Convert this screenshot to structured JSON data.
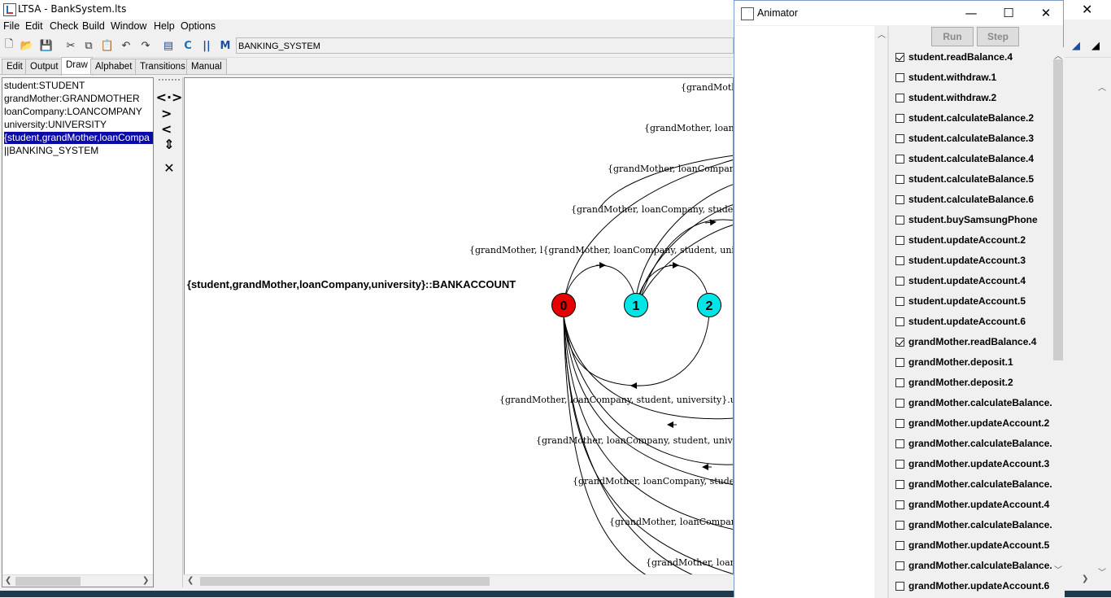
{
  "main_window": {
    "title": "LTSA - BankSystem.lts",
    "menu": [
      "File",
      "Edit",
      "Check",
      "Build",
      "Window",
      "Help",
      "Options"
    ],
    "target": "BANKING_SYSTEM",
    "tabs": [
      "Edit",
      "Output",
      "Draw",
      "Alphabet",
      "Transitions",
      "Manual"
    ],
    "active_tab": "Draw"
  },
  "process_list": [
    "student:STUDENT",
    "grandMother:GRANDMOTHER",
    "loanCompany:LOANCOMPANY",
    "university:UNIVERSITY",
    "{student,grandMother,loanCompa",
    "||BANKING_SYSTEM"
  ],
  "diagram": {
    "process_title": "{student,grandMother,loanCompany,university}::BANKACCOUNT",
    "nodes": [
      {
        "label": "0",
        "color": "#e60000"
      },
      {
        "label": "1",
        "color": "#00e5e5"
      },
      {
        "label": "2",
        "color": "#00e5e5"
      }
    ],
    "edge_labels": [
      "{grandMothe",
      "{grandMother, loanCo",
      "{grandMother, loanCompany, st",
      "{grandMother, loanCompany, student, u",
      "{grandMother, l{grandMother, loanCompany, student, university}",
      "{grandMother, loanCompany, student, university}.updateA",
      "{grandMother, loanCompany, student, university}",
      "{grandMother, loanCompany, student, u",
      "{grandMother, loanCompany, s",
      "{grandMother, loanCo"
    ]
  },
  "animator": {
    "title": "Animator",
    "run_label": "Run",
    "step_label": "Step",
    "actions": [
      {
        "label": "student.readBalance.4",
        "checked": true
      },
      {
        "label": "student.withdraw.1",
        "checked": false
      },
      {
        "label": "student.withdraw.2",
        "checked": false
      },
      {
        "label": "student.calculateBalance.2",
        "checked": false
      },
      {
        "label": "student.calculateBalance.3",
        "checked": false
      },
      {
        "label": "student.calculateBalance.4",
        "checked": false
      },
      {
        "label": "student.calculateBalance.5",
        "checked": false
      },
      {
        "label": "student.calculateBalance.6",
        "checked": false
      },
      {
        "label": "student.buySamsungPhone",
        "checked": false
      },
      {
        "label": "student.updateAccount.2",
        "checked": false
      },
      {
        "label": "student.updateAccount.3",
        "checked": false
      },
      {
        "label": "student.updateAccount.4",
        "checked": false
      },
      {
        "label": "student.updateAccount.5",
        "checked": false
      },
      {
        "label": "student.updateAccount.6",
        "checked": false
      },
      {
        "label": "grandMother.readBalance.4",
        "checked": true
      },
      {
        "label": "grandMother.deposit.1",
        "checked": false
      },
      {
        "label": "grandMother.deposit.2",
        "checked": false
      },
      {
        "label": "grandMother.calculateBalance.",
        "checked": false
      },
      {
        "label": "grandMother.updateAccount.2",
        "checked": false
      },
      {
        "label": "grandMother.calculateBalance.",
        "checked": false
      },
      {
        "label": "grandMother.updateAccount.3",
        "checked": false
      },
      {
        "label": "grandMother.calculateBalance.",
        "checked": false
      },
      {
        "label": "grandMother.updateAccount.4",
        "checked": false
      },
      {
        "label": "grandMother.calculateBalance.",
        "checked": false
      },
      {
        "label": "grandMother.updateAccount.5",
        "checked": false
      },
      {
        "label": "grandMother.calculateBalance.",
        "checked": false
      },
      {
        "label": "grandMother.updateAccount.6",
        "checked": false
      }
    ]
  },
  "icons": {
    "new": "new-file-icon",
    "open": "open-folder-icon",
    "save": "save-icon",
    "cut": "cut-icon",
    "copy": "copy-icon",
    "paste": "paste-icon",
    "undo": "undo-icon",
    "redo": "redo-icon"
  }
}
